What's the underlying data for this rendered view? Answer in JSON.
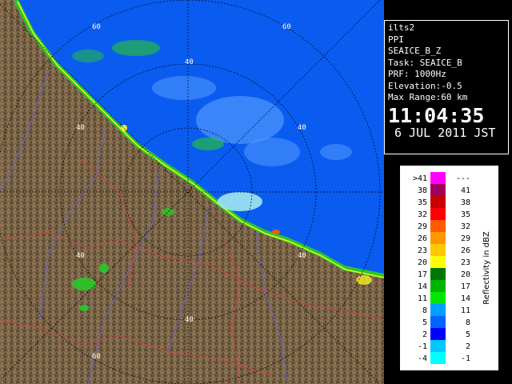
{
  "info": {
    "product": "ilts2",
    "mode": "PPI",
    "variable": "SEAICE_B_Z",
    "task": "Task: SEAICE_B",
    "prf": "PRF: 1000Hz",
    "elevation": "Elevation:-0.5",
    "max_range": "Max Range:60 km",
    "time": "11:04:35",
    "date": "6 JUL 2011 JST"
  },
  "range_labels": [
    "60",
    "40",
    "40",
    "40",
    "40",
    "40",
    "60"
  ],
  "legend": {
    "title": "Reflectivity in dBZ",
    "rows": [
      {
        "left": ">41",
        "right": "---",
        "color": "#ff00ff"
      },
      {
        "left": "38",
        "right": "41",
        "color": "#a0005a"
      },
      {
        "left": "35",
        "right": "38",
        "color": "#c80000"
      },
      {
        "left": "32",
        "right": "35",
        "color": "#ff0000"
      },
      {
        "left": "29",
        "right": "32",
        "color": "#ff5a00"
      },
      {
        "left": "26",
        "right": "29",
        "color": "#ff9600"
      },
      {
        "left": "23",
        "right": "26",
        "color": "#ffc800"
      },
      {
        "left": "20",
        "right": "23",
        "color": "#ffff00"
      },
      {
        "left": "17",
        "right": "20",
        "color": "#007800"
      },
      {
        "left": "14",
        "right": "17",
        "color": "#00b400"
      },
      {
        "left": "11",
        "right": "14",
        "color": "#00e600"
      },
      {
        "left": "8",
        "right": "11",
        "color": "#00a0ff"
      },
      {
        "left": "5",
        "right": "8",
        "color": "#0064ff"
      },
      {
        "left": "2",
        "right": "5",
        "color": "#0000ff"
      },
      {
        "left": "-1",
        "right": "2",
        "color": "#00c8ff"
      },
      {
        "left": "-4",
        "right": "-1",
        "color": "#00ffff"
      }
    ]
  },
  "colors": {
    "sea": "#0a5cf0",
    "land": "#7a6448",
    "echo_weak": "#5aa0ff",
    "echo_light": "#a0e6f0",
    "echo_green": "#28c828",
    "echo_yellow": "#f0f028",
    "river": "#6464c8",
    "border": "#c84646"
  }
}
